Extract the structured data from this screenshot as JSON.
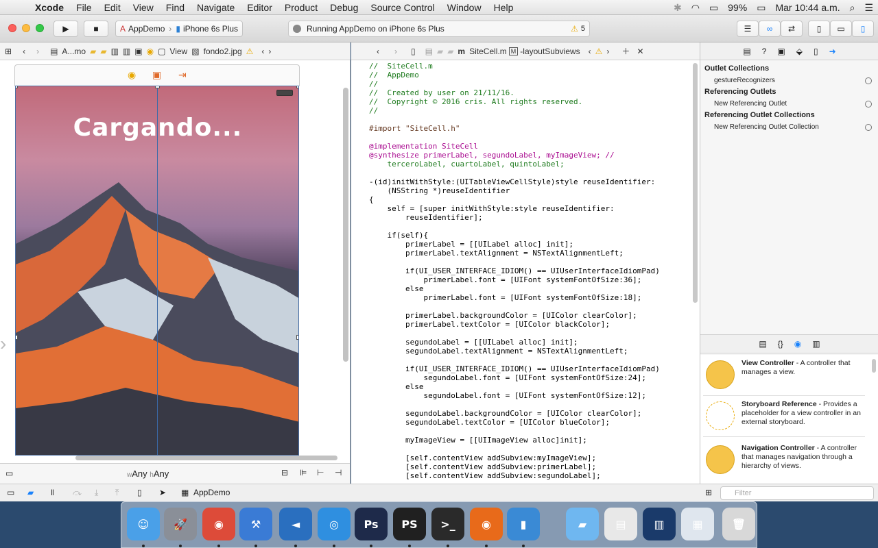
{
  "menubar": {
    "app": "Xcode",
    "items": [
      "File",
      "Edit",
      "View",
      "Find",
      "Navigate",
      "Editor",
      "Product",
      "Debug",
      "Source Control",
      "Window",
      "Help"
    ],
    "battery": "99%",
    "clock": "Mar 10:44 a.m."
  },
  "toolbar": {
    "scheme": "AppDemo",
    "device": "iPhone 6s Plus",
    "status": "Running AppDemo on iPhone 6s Plus",
    "warnings": "5"
  },
  "left_jumpbar": {
    "crumbs": [
      "A...mo",
      "View",
      "fondo2.jpg"
    ]
  },
  "right_jumpbar": {
    "file": "SiteCell.m",
    "method": "-layoutSubviews"
  },
  "canvas": {
    "overlay_text": "Cargando...",
    "size_class": "wAny hAny",
    "w_prefix": "w",
    "w_value": "Any",
    "h_prefix": "h",
    "h_value": "Any"
  },
  "code_lines": [
    {
      "cls": "c",
      "text": "//  SiteCell.m"
    },
    {
      "cls": "c",
      "text": "//  AppDemo"
    },
    {
      "cls": "c",
      "text": "//"
    },
    {
      "cls": "c",
      "text": "//  Created by user on 21/11/16."
    },
    {
      "cls": "c",
      "text": "//  Copyright © 2016 cris. All rights reserved."
    },
    {
      "cls": "c",
      "text": "//"
    },
    {
      "cls": "",
      "text": ""
    },
    {
      "cls": "p",
      "text": "#import \"SiteCell.h\""
    },
    {
      "cls": "",
      "text": ""
    },
    {
      "cls": "k",
      "text": "@implementation SiteCell"
    },
    {
      "cls": "k",
      "text": "@synthesize primerLabel, segundoLabel, myImageView; //"
    },
    {
      "cls": "c",
      "text": "    terceroLabel, cuartoLabel, quintoLabel;"
    },
    {
      "cls": "",
      "text": ""
    },
    {
      "cls": "",
      "text": "-(id)initWithStyle:(UITableViewCellStyle)style reuseIdentifier:"
    },
    {
      "cls": "",
      "text": "    (NSString *)reuseIdentifier"
    },
    {
      "cls": "",
      "text": "{"
    },
    {
      "cls": "",
      "text": "    self = [super initWithStyle:style reuseIdentifier:"
    },
    {
      "cls": "",
      "text": "        reuseIdentifier];"
    },
    {
      "cls": "",
      "text": ""
    },
    {
      "cls": "",
      "text": "    if(self){"
    },
    {
      "cls": "",
      "text": "        primerLabel = [[UILabel alloc] init];"
    },
    {
      "cls": "",
      "text": "        primerLabel.textAlignment = NSTextAlignmentLeft;"
    },
    {
      "cls": "",
      "text": ""
    },
    {
      "cls": "",
      "text": "        if(UI_USER_INTERFACE_IDIOM() == UIUserInterfaceIdiomPad)"
    },
    {
      "cls": "",
      "text": "            primerLabel.font = [UIFont systemFontOfSize:36];"
    },
    {
      "cls": "",
      "text": "        else"
    },
    {
      "cls": "",
      "text": "            primerLabel.font = [UIFont systemFontOfSize:18];"
    },
    {
      "cls": "",
      "text": ""
    },
    {
      "cls": "",
      "text": "        primerLabel.backgroundColor = [UIColor clearColor];"
    },
    {
      "cls": "",
      "text": "        primerLabel.textColor = [UIColor blackColor];"
    },
    {
      "cls": "",
      "text": ""
    },
    {
      "cls": "",
      "text": "        segundoLabel = [[UILabel alloc] init];"
    },
    {
      "cls": "",
      "text": "        segundoLabel.textAlignment = NSTextAlignmentLeft;"
    },
    {
      "cls": "",
      "text": ""
    },
    {
      "cls": "",
      "text": "        if(UI_USER_INTERFACE_IDIOM() == UIUserInterfaceIdiomPad)"
    },
    {
      "cls": "",
      "text": "            segundoLabel.font = [UIFont systemFontOfSize:24];"
    },
    {
      "cls": "",
      "text": "        else"
    },
    {
      "cls": "",
      "text": "            segundoLabel.font = [UIFont systemFontOfSize:12];"
    },
    {
      "cls": "",
      "text": ""
    },
    {
      "cls": "",
      "text": "        segundoLabel.backgroundColor = [UIColor clearColor];"
    },
    {
      "cls": "",
      "text": "        segundoLabel.textColor = [UIColor blueColor];"
    },
    {
      "cls": "",
      "text": ""
    },
    {
      "cls": "",
      "text": "        myImageView = [[UIImageView alloc]init];"
    },
    {
      "cls": "",
      "text": ""
    },
    {
      "cls": "",
      "text": "        [self.contentView addSubview:myImageView];"
    },
    {
      "cls": "",
      "text": "        [self.contentView addSubview:primerLabel];"
    },
    {
      "cls": "",
      "text": "        [self.contentView addSubview:segundoLabel];"
    }
  ],
  "inspector": {
    "sections": [
      {
        "title": "Outlet Collections",
        "rows": [
          "gestureRecognizers"
        ]
      },
      {
        "title": "Referencing Outlets",
        "rows": [
          "New Referencing Outlet"
        ]
      },
      {
        "title": "Referencing Outlet Collections",
        "rows": [
          "New Referencing Outlet Collection"
        ]
      }
    ]
  },
  "library": {
    "items": [
      {
        "title": "View Controller",
        "desc": " - A controller that manages a view."
      },
      {
        "title": "Storyboard Reference",
        "desc": " - Provides a placeholder for a view controller in an external storyboard."
      },
      {
        "title": "Navigation Controller",
        "desc": " - A controller that manages navigation through a hierarchy of views."
      }
    ],
    "filter_placeholder": "Filter"
  },
  "bottombar": {
    "target": "AppDemo"
  },
  "dock_apps": [
    "Finder",
    "Launchpad",
    "Google Chrome",
    "Xcode",
    "Visual Studio Code",
    "Safari",
    "Photoshop",
    "PhpStorm",
    "Terminal",
    "Firefox",
    "Simulator",
    "Folder",
    "Preview",
    "Document",
    "Screenshot",
    "Trash"
  ],
  "colors": {
    "accent": "#1a82fb",
    "code_comment": "#1d7a1d",
    "code_keyword": "#aa0d91",
    "code_string": "#c41a16"
  }
}
